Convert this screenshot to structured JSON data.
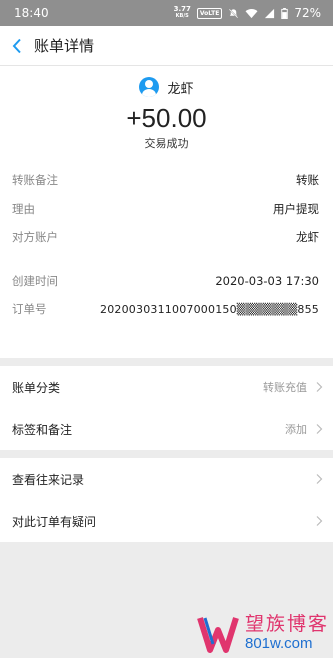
{
  "status_bar": {
    "time": "18:40",
    "net_speed_value": "3.77",
    "net_speed_unit": "KB/S",
    "volte": "VoLTE",
    "battery": "72%"
  },
  "header": {
    "title": "账单详情"
  },
  "summary": {
    "name": "龙虾",
    "amount": "+50.00",
    "status": "交易成功"
  },
  "details": {
    "rows": [
      {
        "label": "转账备注",
        "value": "转账"
      },
      {
        "label": "理由",
        "value": "用户提现"
      },
      {
        "label": "对方账户",
        "value": "龙虾"
      }
    ],
    "rows2": [
      {
        "label": "创建时间",
        "value": "2020-03-03 17:30"
      },
      {
        "label": "订单号",
        "value": "2020030311007000150▒▒▒▒▒▒▒855"
      }
    ]
  },
  "section1": [
    {
      "label": "账单分类",
      "value": "转账充值"
    },
    {
      "label": "标签和备注",
      "value": "添加"
    }
  ],
  "section2": [
    {
      "label": "查看往来记录"
    },
    {
      "label": "对此订单有疑问"
    }
  ],
  "watermark": {
    "name": "望族博客",
    "url": "801w.com"
  },
  "colors": {
    "accent": "#1e9bf0",
    "watermark_pink": "#e0356e",
    "watermark_blue": "#1e6fd0"
  },
  "icons": {
    "back": "chevron-left-icon",
    "avatar": "user-avatar-icon",
    "more": "chevron-right-icon",
    "silent": "bell-off-icon",
    "wifi": "wifi-icon",
    "signal": "signal-icon",
    "battery": "battery-icon"
  }
}
